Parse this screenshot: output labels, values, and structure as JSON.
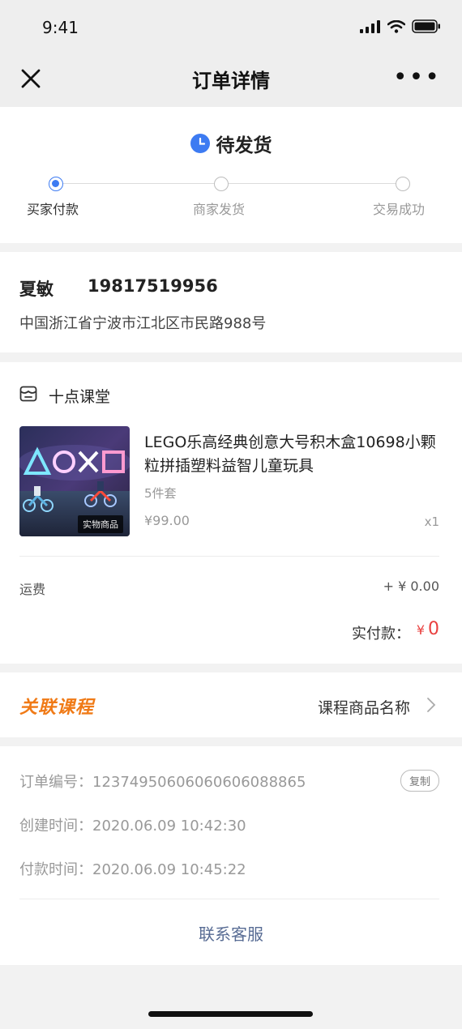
{
  "status_bar": {
    "time": "9:41"
  },
  "nav": {
    "title": "订单详情",
    "more": "•••"
  },
  "order_status": {
    "title": "待发货",
    "steps": [
      {
        "label": "买家付款",
        "active": true
      },
      {
        "label": "商家发货",
        "active": false
      },
      {
        "label": "交易成功",
        "active": false
      }
    ]
  },
  "address": {
    "name": "夏敏",
    "phone": "19817519956",
    "detail": "中国浙江省宁波市江北区市民路988号"
  },
  "shop": {
    "name": "十点课堂"
  },
  "product": {
    "title": "LEGO乐高经典创意大号积木盒10698小颗粒拼插塑料益智儿童玩具",
    "spec": "5件套",
    "price": "¥99.00",
    "quantity": "x1",
    "tag": "实物商品"
  },
  "fees": {
    "shipping_label": "运费",
    "shipping_value": "+ ¥ 0.00",
    "paid_label": "实付款：",
    "paid_currency": "¥",
    "paid_value": "0"
  },
  "related_course": {
    "label": "关联课程",
    "name": "课程商品名称"
  },
  "order_info": {
    "number_label": "订单编号：",
    "number_value": "12374950606060606088865",
    "copy_label": "复制",
    "created_label": "创建时间：",
    "created_value": "2020.06.09 10:42:30",
    "paid_label": "付款时间：",
    "paid_value": "2020.06.09 10:45:22"
  },
  "service": {
    "label": "联系客服"
  },
  "colors": {
    "accent_blue": "#3d7bf2",
    "price_red": "#e9403f",
    "course_orange": "#f07a16",
    "link_blue": "#586c94"
  }
}
